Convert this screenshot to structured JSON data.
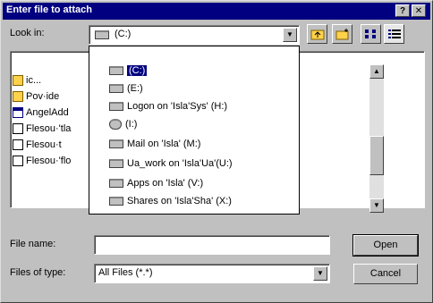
{
  "window": {
    "title": "Enter file to attach",
    "help_button": "?",
    "close_button": "✕"
  },
  "look_in": {
    "label": "Look in:",
    "value": "(C:)"
  },
  "file_list": [
    {
      "name": "ic..."
    },
    {
      "name": "Pov·ide"
    },
    {
      "name": "AngelAdd"
    },
    {
      "name": "Flesou·'tla"
    },
    {
      "name": "Flesou·t"
    },
    {
      "name": "Flesou·'flo"
    }
  ],
  "drop_list": {
    "items": [
      {
        "label": "(C:)",
        "selected": true
      },
      {
        "label": "(E:)",
        "selected": false
      },
      {
        "label": "Logon on 'Isla'Sys' (H:)",
        "selected": false
      },
      {
        "label": "(I:)",
        "selected": false
      },
      {
        "label": "Mail on 'Isla' (M:)",
        "selected": false
      },
      {
        "label": "Ua_work on 'Isla'Ua'(U:)",
        "selected": false
      },
      {
        "label": "Apps on 'Isla' (V:)",
        "selected": false
      },
      {
        "label": "Shares on 'Isla'Sha' (X:)",
        "selected": false
      }
    ]
  },
  "file_name": {
    "label": "File name:",
    "value": ""
  },
  "file_type": {
    "label": "Files of type:",
    "value": "All Files (*.*)"
  },
  "buttons": {
    "open": "Open",
    "cancel": "Cancel"
  },
  "colors": {
    "titlebar": "#000080",
    "face": "#c0c0c0",
    "selection": "#000080"
  }
}
